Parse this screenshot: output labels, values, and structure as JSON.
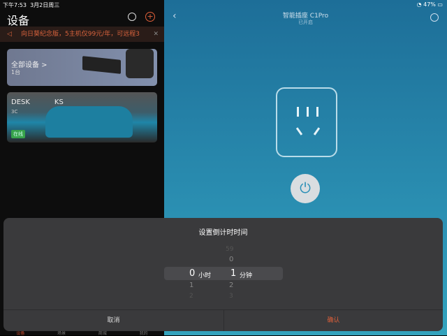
{
  "status_bar": {
    "time": "下午7:53",
    "date": "3月2日周三",
    "battery": "47%"
  },
  "left": {
    "title": "设备",
    "notice": "向日葵纪念版，5主机仅99元/年，可远程3",
    "card_all": {
      "title": "全部设备 >",
      "count": "1台"
    },
    "card_device": {
      "name": "DESK           KS",
      "sub": "3C",
      "badge": "在线"
    },
    "tabs": [
      "设备",
      "场景",
      "商城",
      "我的"
    ]
  },
  "detail": {
    "title": "智能插座 C1Pro",
    "subtitle": "已开启"
  },
  "sheet": {
    "title": "设置倒计时时间",
    "hours": {
      "above": "",
      "selected": "0",
      "below": [
        "1",
        "2"
      ],
      "unit": "小时"
    },
    "minutes": {
      "above": [
        "59",
        "0"
      ],
      "selected": "1",
      "below": [
        "2",
        "3"
      ],
      "unit": "分钟"
    },
    "cancel": "取消",
    "confirm": "确认"
  },
  "colors": {
    "accent": "#e0603a"
  }
}
